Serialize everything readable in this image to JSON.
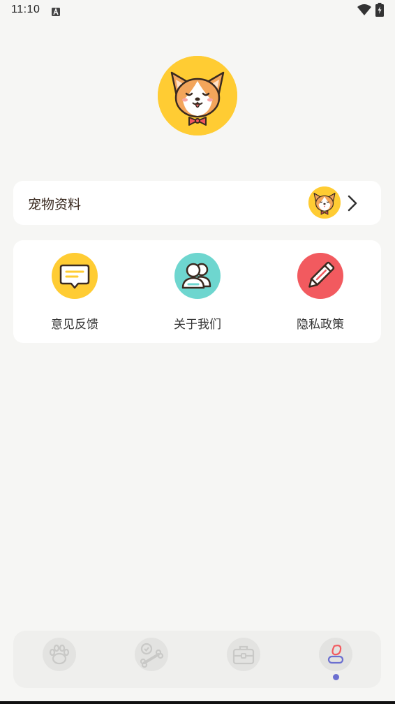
{
  "status_bar": {
    "time": "11:10"
  },
  "pet_profile": {
    "label": "宠物资料"
  },
  "menu": {
    "items": [
      {
        "label": "意见反馈",
        "icon": "feedback-icon",
        "color": "#ffcc33"
      },
      {
        "label": "关于我们",
        "icon": "users-icon",
        "color": "#6ed6cf"
      },
      {
        "label": "隐私政策",
        "icon": "pen-icon",
        "color": "#f25a5f"
      }
    ]
  },
  "tab_bar": {
    "tabs": [
      {
        "name": "paw-icon",
        "active": false
      },
      {
        "name": "bone-icon",
        "active": false
      },
      {
        "name": "briefcase-icon",
        "active": false
      },
      {
        "name": "profile-icon",
        "active": true
      }
    ]
  },
  "colors": {
    "accent": "#6b6fd0",
    "avatar_bg": "#ffcc33",
    "background": "#f6f6f4"
  }
}
